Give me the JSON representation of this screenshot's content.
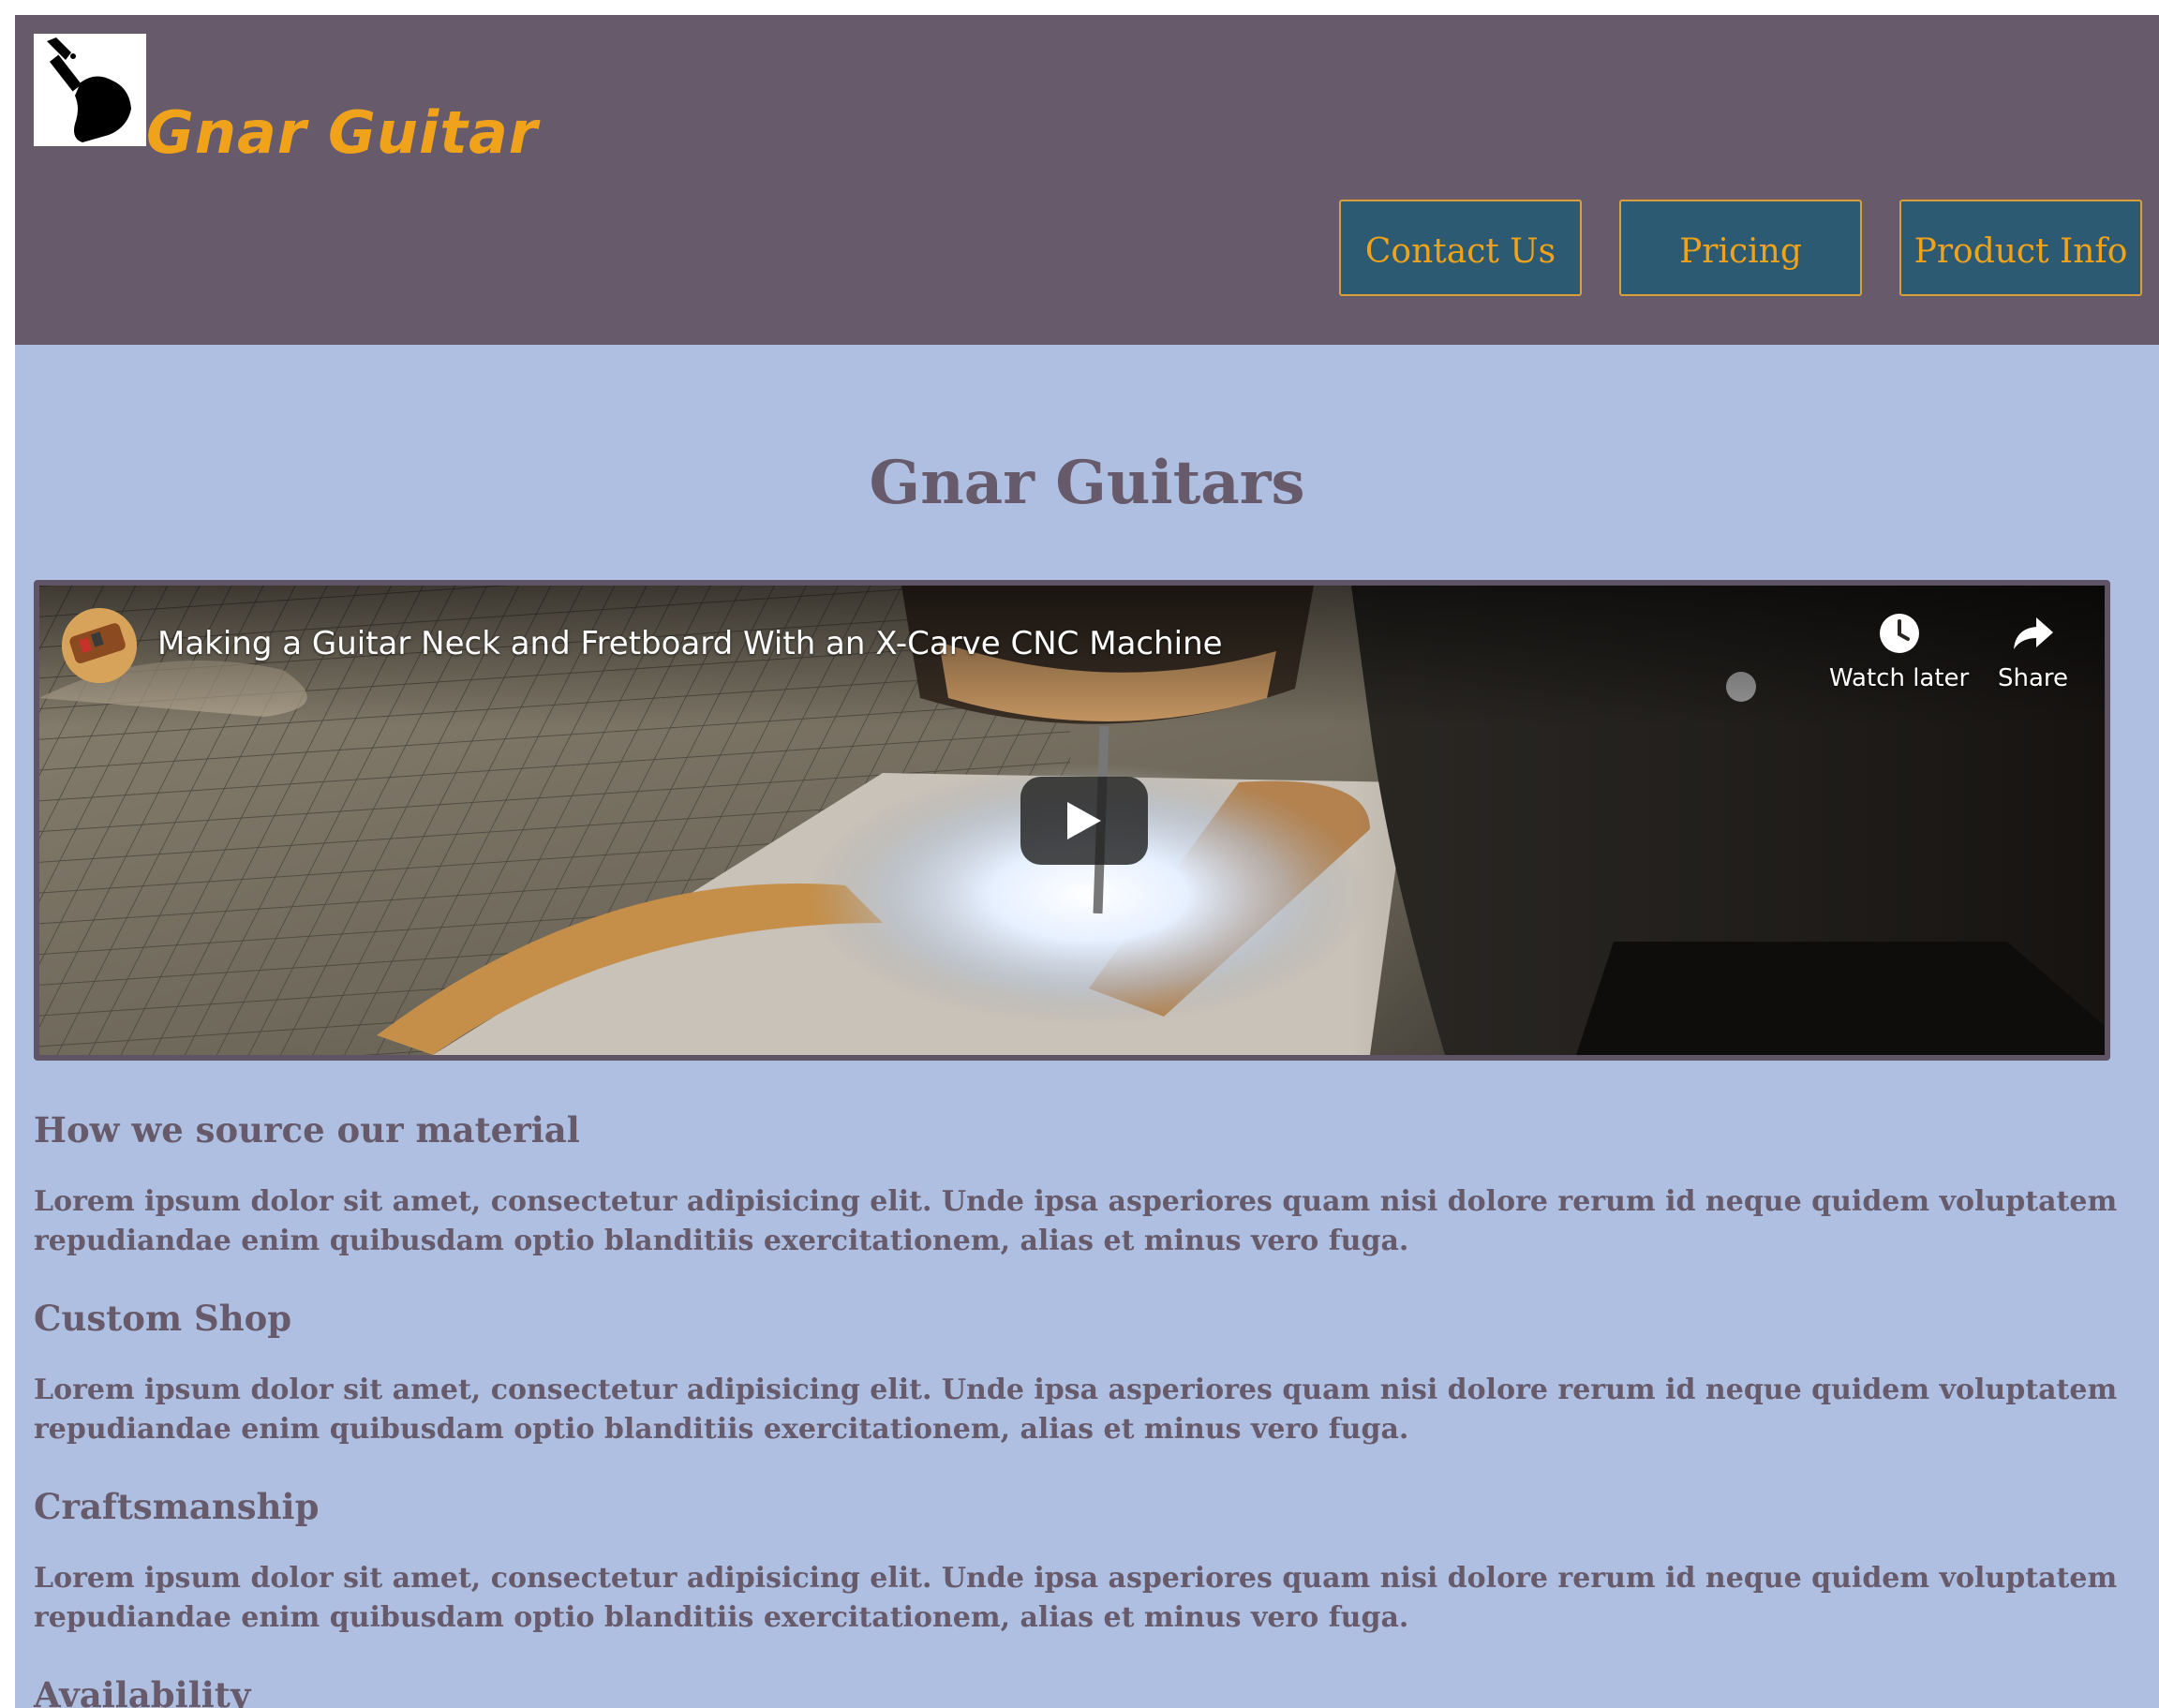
{
  "header": {
    "brand_name": "Gnar Guitar",
    "logo_icon": "guitar-hand-logo-icon",
    "nav": [
      {
        "label": "Contact Us"
      },
      {
        "label": "Pricing"
      },
      {
        "label": "Product Info"
      }
    ]
  },
  "main": {
    "page_title": "Gnar Guitars",
    "video": {
      "title": "Making a Guitar Neck and Fretboard With an X-Carve CNC Machine",
      "watch_later_label": "Watch later",
      "share_label": "Share",
      "play_icon": "play-icon"
    },
    "sections": [
      {
        "heading": "How we source our material",
        "text": "Lorem ipsum dolor sit amet, consectetur adipisicing elit. Unde ipsa asperiores quam nisi dolore rerum id neque quidem voluptatem repudiandae enim quibusdam optio blanditiis exercitationem, alias et minus vero fuga."
      },
      {
        "heading": "Custom Shop",
        "text": "Lorem ipsum dolor sit amet, consectetur adipisicing elit. Unde ipsa asperiores quam nisi dolore rerum id neque quidem voluptatem repudiandae enim quibusdam optio blanditiis exercitationem, alias et minus vero fuga."
      },
      {
        "heading": "Craftsmanship",
        "text": "Lorem ipsum dolor sit amet, consectetur adipisicing elit. Unde ipsa asperiores quam nisi dolore rerum id neque quidem voluptatem repudiandae enim quibusdam optio blanditiis exercitationem, alias et minus vero fuga."
      },
      {
        "heading": "Availability",
        "text": ""
      }
    ]
  },
  "colors": {
    "header_bg": "#675b6b",
    "page_bg": "#aebfe2",
    "brand_accent": "#f0a31a",
    "nav_button_bg": "#2c5a72"
  }
}
